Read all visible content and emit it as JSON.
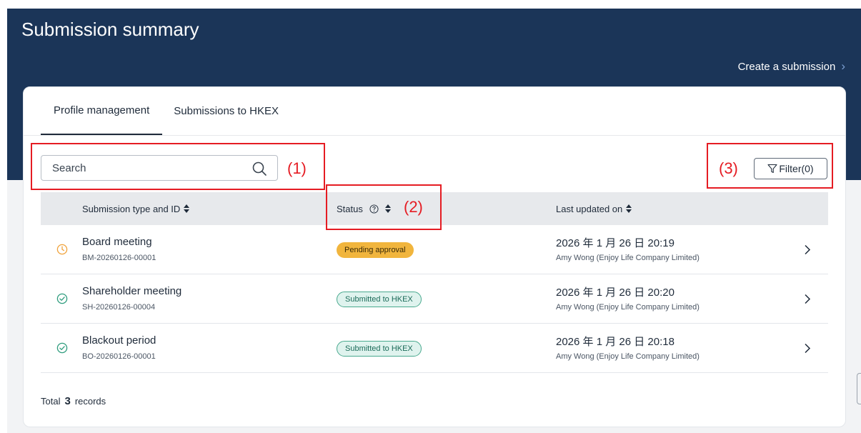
{
  "header": {
    "title": "Submission summary",
    "create_link": "Create a submission",
    "create_chevron": "›"
  },
  "tabs": [
    {
      "label": "Profile management",
      "active": true
    },
    {
      "label": "Submissions to HKEX",
      "active": false
    }
  ],
  "search": {
    "placeholder": "Search",
    "value": ""
  },
  "filter": {
    "label": "Filter(0)"
  },
  "table": {
    "columns": {
      "type": "Submission type and ID",
      "status": "Status",
      "updated": "Last updated on"
    },
    "rows": [
      {
        "icon": "clock-icon",
        "icon_color": "#f0a23a",
        "type": "Board meeting",
        "id": "BM-20260126-00001",
        "status": "Pending approval",
        "updated": "2026 年 1 月 26 日 20:19",
        "by": "Amy Wong (Enjoy Life Company Limited)"
      },
      {
        "icon": "check-circle-icon",
        "icon_color": "#2e9c7d",
        "type": "Shareholder meeting",
        "id": "SH-20260126-00004",
        "status": "Submitted to HKEX",
        "updated": "2026 年 1 月 26 日 20:20",
        "by": "Amy Wong (Enjoy Life Company Limited)"
      },
      {
        "icon": "check-circle-icon",
        "icon_color": "#2e9c7d",
        "type": "Blackout period",
        "id": "BO-20260126-00001",
        "status": "Submitted to HKEX",
        "updated": "2026 年 1 月 26 日 20:18",
        "by": "Amy Wong (Enjoy Life Company Limited)"
      }
    ]
  },
  "footer": {
    "total_label": "Total",
    "total_count": "3",
    "records_label": "records"
  },
  "annotations": [
    "(1)",
    "(2)",
    "(3)"
  ],
  "colors": {
    "header_bg": "#1b3558",
    "pending": "#f1b53d",
    "submitted": "#2e9c7d",
    "annotation": "#e51c23"
  }
}
